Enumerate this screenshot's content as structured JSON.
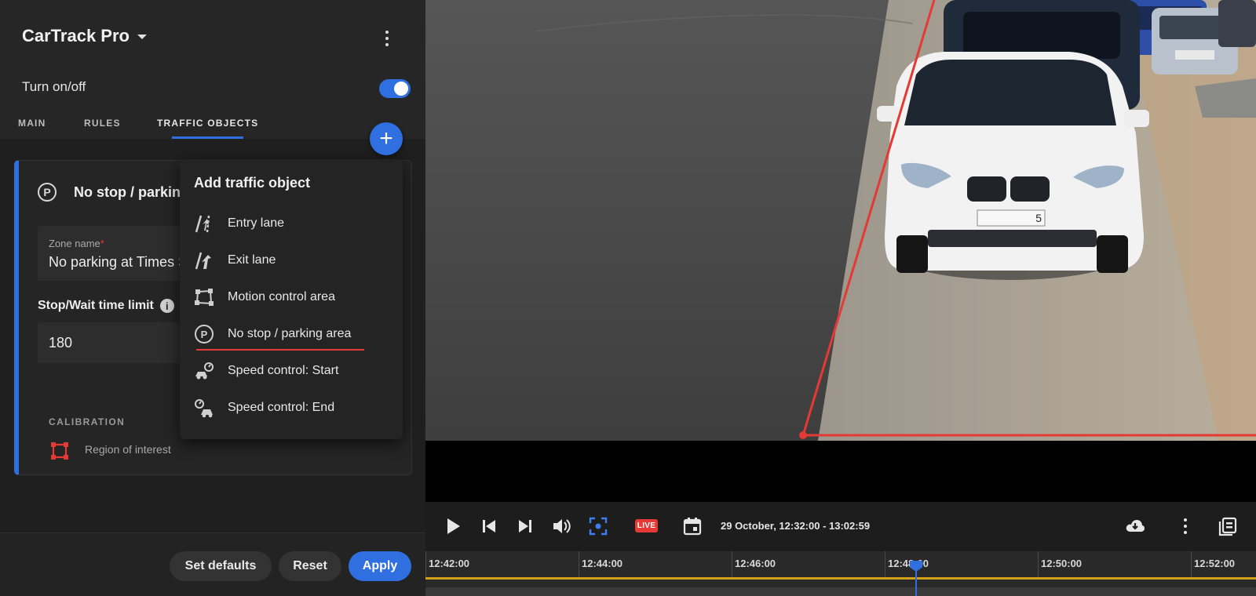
{
  "app": {
    "title": "CarTrack Pro"
  },
  "toggle": {
    "label": "Turn on/off",
    "on": true
  },
  "tabs": [
    {
      "label": "MAIN",
      "active": false
    },
    {
      "label": "RULES",
      "active": false
    },
    {
      "label": "TRAFFIC OBJECTS",
      "active": true
    }
  ],
  "fab": {
    "icon": "plus-icon",
    "label": "+"
  },
  "card": {
    "icon_letter": "P",
    "title": "No stop / parking area",
    "zone_name_label": "Zone name",
    "zone_name_required": "*",
    "zone_name_value": "No parking at Times Square",
    "stop_wait_label": "Stop/Wait time limit",
    "info_glyph": "i",
    "stop_wait_value": "180",
    "calibration_title": "CALIBRATION",
    "roi_label": "Region of interest"
  },
  "menu": {
    "title": "Add traffic object",
    "items": [
      {
        "label": "Entry lane",
        "icon": "entry-lane-icon"
      },
      {
        "label": "Exit lane",
        "icon": "exit-lane-icon"
      },
      {
        "label": "Motion control area",
        "icon": "motion-area-icon"
      },
      {
        "label": "No stop / parking area",
        "icon": "parking-icon",
        "selected": true
      },
      {
        "label": "Speed control: Start",
        "icon": "speed-start-icon"
      },
      {
        "label": "Speed control: End",
        "icon": "speed-end-icon"
      }
    ]
  },
  "footer": {
    "set_defaults": "Set defaults",
    "reset": "Reset",
    "apply": "Apply"
  },
  "player": {
    "live_label": "LIVE",
    "range": "29 October, 12:32:00 - 13:02:59",
    "plate_text": "5",
    "ticks": [
      "12:42:00",
      "12:44:00",
      "12:46:00",
      "12:48:00",
      "12:50:00",
      "12:52:00"
    ]
  },
  "colors": {
    "accent": "#2f6fe0",
    "danger": "#e53935",
    "timeline": "#d4a017"
  }
}
